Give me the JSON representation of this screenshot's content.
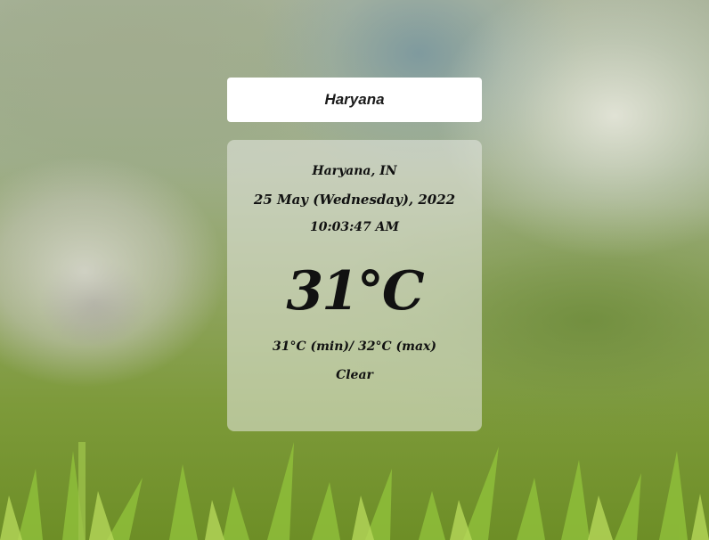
{
  "search": {
    "value": "Haryana"
  },
  "weather": {
    "location": "Haryana, IN",
    "date": "25 May (Wednesday), 2022",
    "time": "10:03:47 AM",
    "temperature": "31°C",
    "min_max": "31°C (min)/ 32°C (max)",
    "condition": "Clear"
  },
  "colors": {
    "search_bg": "#ffffff",
    "card_bg": "rgba(232,234,228,0.55)",
    "text": "#111111"
  },
  "background": {
    "icon": "dandelion-grass-backdrop"
  }
}
